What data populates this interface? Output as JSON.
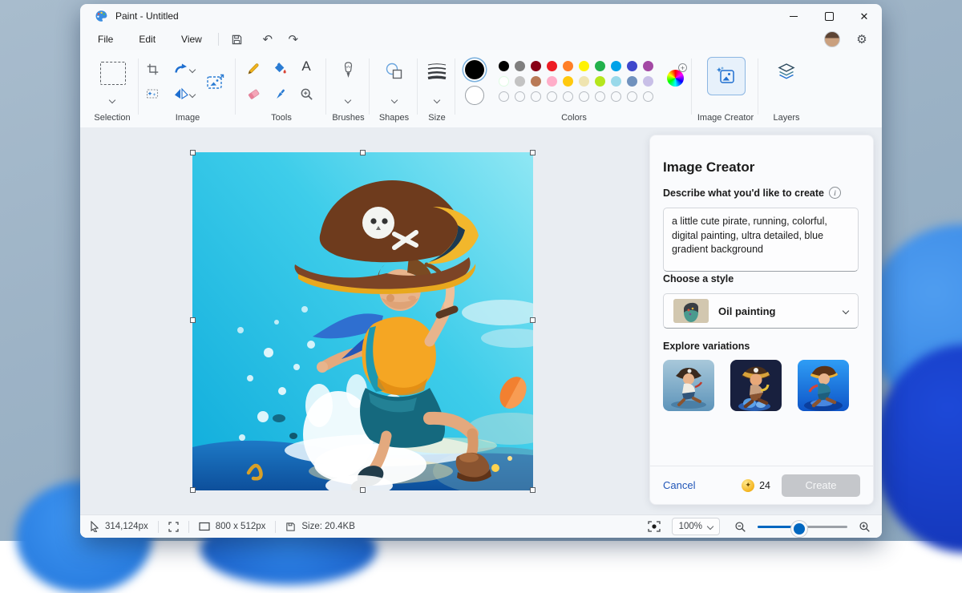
{
  "titlebar": {
    "title": "Paint - Untitled"
  },
  "menubar": {
    "items": [
      "File",
      "Edit",
      "View"
    ]
  },
  "icons": {
    "gear": "⚙",
    "undo": "↶",
    "redo": "↷",
    "close": "✕",
    "info": "i",
    "plus": "+"
  },
  "ribbon": {
    "groups": [
      "Selection",
      "Image",
      "Tools",
      "Brushes",
      "Shapes",
      "Size",
      "Colors",
      "Image Creator",
      "Layers"
    ],
    "palette": {
      "foreground": "#000000",
      "background": "#ffffff",
      "row1": [
        "#000000",
        "#7f7f7f",
        "#880015",
        "#ed1c24",
        "#ff7f27",
        "#fff200",
        "#22b14c",
        "#00a2e8",
        "#3f48cc",
        "#a349a4"
      ],
      "row2": [
        "#ffffff",
        "#c3c3c3",
        "#b97a57",
        "#ffaec9",
        "#ffc90e",
        "#efe4b0",
        "#b5e61d",
        "#99d9ea",
        "#7092be",
        "#c8bfe7"
      ],
      "empty_slots": 10
    }
  },
  "panel": {
    "title": "Image Creator",
    "describe_label": "Describe what you'd like to create",
    "prompt": "a little cute pirate, running, colorful, digital painting, ultra detailed, blue gradient background",
    "style_label": "Choose a style",
    "style_value": "Oil painting",
    "variations_label": "Explore variations",
    "cancel_label": "Cancel",
    "credits": "24",
    "create_label": "Create"
  },
  "statusbar": {
    "cursor_pos": "314,124px",
    "canvas_size": "800  x  512px",
    "file_size": "Size: 20.4KB",
    "zoom": "100%"
  },
  "accent": "#0067c0"
}
